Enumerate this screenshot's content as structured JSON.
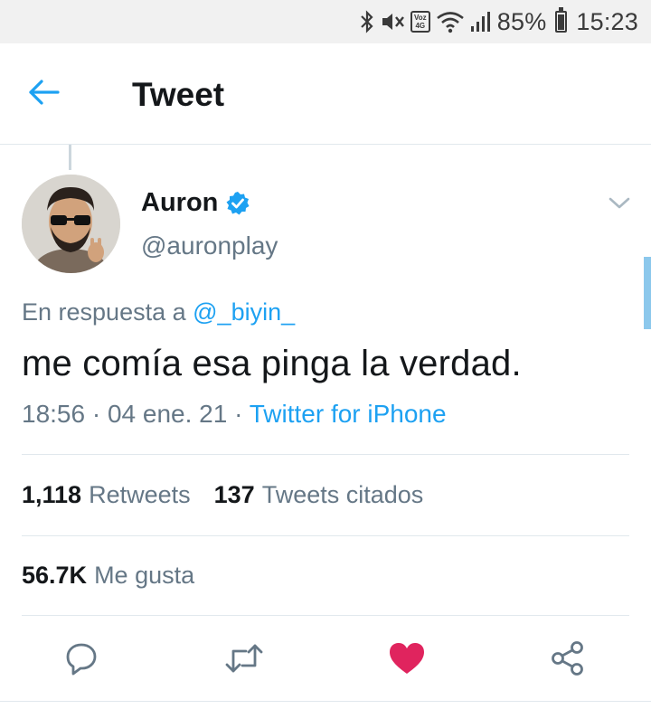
{
  "status_bar": {
    "volte_top": "Voz",
    "volte_bottom": "4G",
    "battery_percent": "85%",
    "battery_level": 0.85,
    "time": "15:23",
    "icons": [
      "bluetooth-icon",
      "mute-vibrate-icon",
      "volte-icon",
      "wifi-icon",
      "signal-icon",
      "battery-icon"
    ]
  },
  "header": {
    "title": "Tweet",
    "back_icon": "arrow-left-icon"
  },
  "tweet": {
    "author": {
      "name": "Auron",
      "handle": "@auronplay",
      "verified": true
    },
    "reply_prefix": "En respuesta a",
    "reply_mention": "@_biyin_",
    "text": "me comía esa pinga la verdad.",
    "time": "18:56",
    "date": "04 ene. 21",
    "client": "Twitter for iPhone",
    "separator": "·"
  },
  "stats": {
    "retweets_count": "1,118",
    "retweets_label": "Retweets",
    "quotes_count": "137",
    "quotes_label": "Tweets citados",
    "likes_count": "56.7K",
    "likes_label": "Me gusta"
  },
  "actions": {
    "icons": [
      "reply-icon",
      "retweet-icon",
      "like-heart-icon",
      "share-icon"
    ],
    "like_color": "#e0245e",
    "icon_color": "#657786"
  },
  "colors": {
    "accent": "#1da1f2",
    "secondary_text": "#657786",
    "primary_text": "#14171a"
  }
}
